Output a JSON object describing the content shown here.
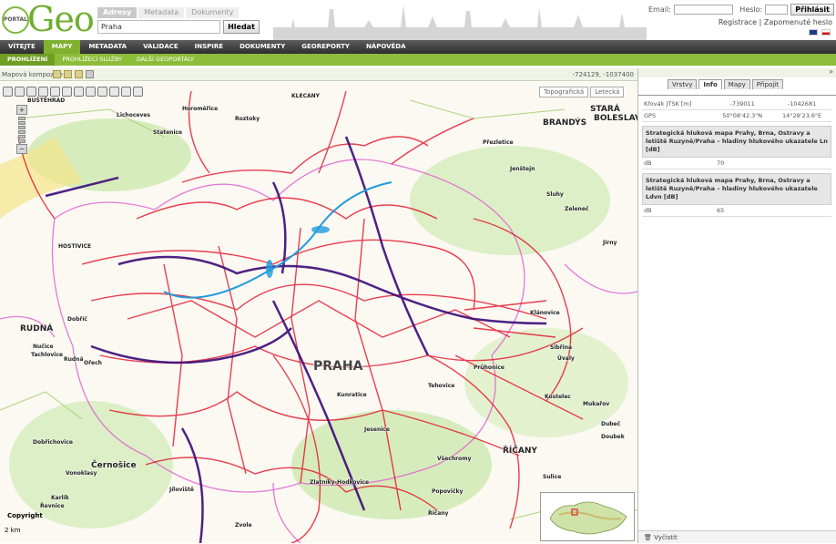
{
  "logo": {
    "portal": "PORTAL",
    "geo": "Geo"
  },
  "search": {
    "tabs": [
      {
        "label": "Adresy"
      },
      {
        "label": "Metadata"
      },
      {
        "label": "Dokumenty"
      }
    ],
    "value": "Praha",
    "button": "Hledat"
  },
  "login": {
    "email_label": "Email:",
    "password_label": "Heslo:",
    "button": "Přihlásit",
    "register": "Registrace",
    "separator": "|",
    "forgot": "Zapomenuté heslo"
  },
  "nav": {
    "items": [
      {
        "label": "VÍTEJTE"
      },
      {
        "label": "MAPY"
      },
      {
        "label": "METADATA"
      },
      {
        "label": "VALIDACE"
      },
      {
        "label": "INSPIRE"
      },
      {
        "label": "DOKUMENTY"
      },
      {
        "label": "GEOREPORTY"
      },
      {
        "label": "NÁPOVĚDA"
      }
    ]
  },
  "subnav": {
    "items": [
      {
        "label": "PROHLÍŽENÍ"
      },
      {
        "label": "PROHLÍŽECÍ SLUŽBY"
      },
      {
        "label": "DALŠÍ GEOPORTÁLY"
      }
    ]
  },
  "map": {
    "title": "Mapová kompozice",
    "coords": "-724129, -1037400",
    "basemaps": [
      "Topografická",
      "Letecká"
    ],
    "copyright": "Copyright",
    "scale": "2 km",
    "labels": [
      "BUŠTĚHRAD",
      "KLECANY",
      "STARÁ",
      "BOLESLAV",
      "BRANDÝS",
      "Lichoceves",
      "Statenice",
      "Roztoky",
      "Horoměřice",
      "Přezletice",
      "Jenštejn",
      "Sluhy",
      "Zeleneč",
      "Jirny",
      "HOSTIVICE",
      "Dobříč",
      "RUDNÁ",
      "Nučice",
      "Tachlovice",
      "Rudná",
      "Ořech",
      "PRAHA",
      "Tehovice",
      "Průhonice",
      "Mukařov",
      "ŘÍČANY",
      "Kostelec",
      "Dobřichovice",
      "Černošice",
      "Vonoklasy",
      "Karlík",
      "Řevnice",
      "Jíloviště",
      "Zlatníky-Hodkovice",
      "Popovičky",
      "Zvole",
      "Jesenice",
      "Kunratice",
      "Říčany",
      "Sibřina",
      "Úvaly",
      "Dubeč",
      "Doubek",
      "Sulice",
      "Všechromy",
      "Klánovice"
    ]
  },
  "panel": {
    "tabs": [
      {
        "label": "Vrstvy"
      },
      {
        "label": "Info"
      },
      {
        "label": "Mapy"
      },
      {
        "label": "Připojit"
      }
    ],
    "rows": [
      {
        "key": "Křovák JTSK [m]",
        "x": "-739011",
        "y": "-1042681"
      },
      {
        "key": "GPS",
        "x": "50°08'42.3\"N",
        "y": "14°28'23.6\"E"
      }
    ],
    "results": [
      {
        "header": "Strategická hluková mapa Prahy, Brna, Ostravy a letiště Ruzyně/Praha – hladiny hlukového ukazatele Ln [dB]",
        "unit": "dB",
        "value": "70"
      },
      {
        "header": "Strategická hluková mapa Prahy, Brna, Ostravy a letiště Ruzyně/Praha – hladiny hlukového ukazatele Ldvn [dB]",
        "unit": "dB",
        "value": "65"
      }
    ],
    "clear": "Vyčistit"
  },
  "colors": {
    "accent": "#7fb12f",
    "noise": "#e3001b",
    "roads": "#3b0a78"
  }
}
